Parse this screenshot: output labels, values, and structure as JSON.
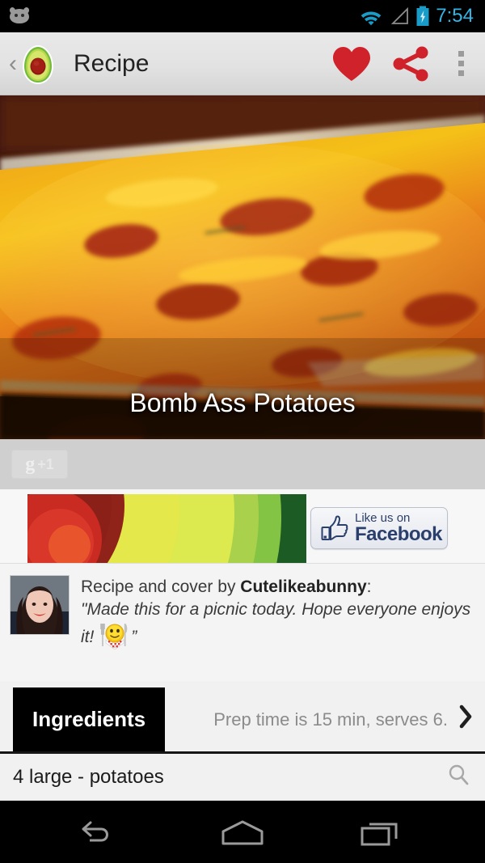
{
  "status_bar": {
    "notification_icon": "android-bean-icon",
    "wifi_icon": "wifi-icon",
    "signal_icon": "signal-triangle-icon",
    "battery_icon": "battery-charging-icon",
    "time": "7:54",
    "time_color": "#33b5e5"
  },
  "action_bar": {
    "back_label": "‹",
    "app_icon": "avocado-icon",
    "title": "Recipe",
    "favorite_icon": "heart-icon",
    "favorite_color": "#d32026",
    "share_icon": "share-icon",
    "share_color": "#d32026",
    "overflow_icon": "overflow-menu-icon"
  },
  "hero": {
    "photo_alt": "baked cheesy potato casserole with bacon in a glass dish",
    "title": "Bomb Ass Potatoes"
  },
  "social": {
    "gplus_label": "+1",
    "gplus_glyph": "g",
    "facebook_small": "Like us on",
    "facebook_big": "Facebook",
    "facebook_icon": "thumbs-up-icon",
    "facebook_color": "#3b5998",
    "banner_art": "avocado-banner-art"
  },
  "author": {
    "avatar_alt": "Cutelikeabunny profile photo",
    "prefix": "Recipe and cover by ",
    "name": "Cutelikeabunny",
    "suffix": ":",
    "quote_part1": "\"Made this for a picnic today.  Hope everyone enjoys it!",
    "quote_emoji": "smiley-with-fork-and-knife-emoticon",
    "quote_part2": "”"
  },
  "tabs": {
    "active_tab": "Ingredients",
    "prep_info": "Prep time is 15 min, serves 6.",
    "next_icon": "chevron-right-icon"
  },
  "ingredients": [
    {
      "text": "4 large - potatoes",
      "search_icon": "search-icon"
    }
  ],
  "nav_bar": {
    "back_icon": "nav-back-icon",
    "home_icon": "nav-home-icon",
    "recents_icon": "nav-recents-icon",
    "icon_color": "#9a9a9a"
  }
}
